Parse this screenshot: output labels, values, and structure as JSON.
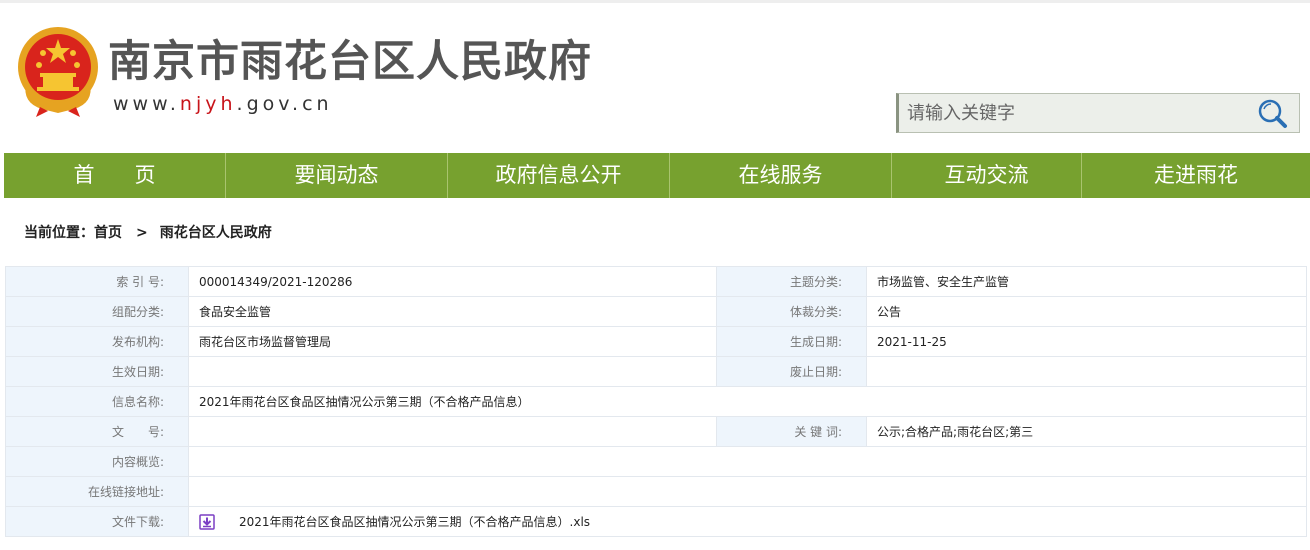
{
  "header": {
    "site_title": "南京市雨花台区人民政府",
    "url_prefix": "www.",
    "url_highlight": "njyh",
    "url_suffix": ".gov.cn",
    "search_placeholder": "请输入关键字",
    "emblem_icon": "national-emblem-icon",
    "search_icon": "search-icon"
  },
  "nav": {
    "items": [
      {
        "label": "首页"
      },
      {
        "label": "要闻动态"
      },
      {
        "label": "政府信息公开"
      },
      {
        "label": "在线服务"
      },
      {
        "label": "互动交流"
      },
      {
        "label": "走进雨花"
      }
    ]
  },
  "breadcrumb": {
    "prefix": "当前位置：",
    "home": "首页",
    "separator": ">",
    "current": "雨花台区人民政府"
  },
  "meta": {
    "index_label": "索 引 号:",
    "index_value": "000014349/2021-120286",
    "topic_label": "主题分类:",
    "topic_value": "市场监管、安全生产监管",
    "group_label": "组配分类:",
    "group_value": "食品安全监管",
    "genre_label": "体裁分类:",
    "genre_value": "公告",
    "publisher_label": "发布机构:",
    "publisher_value": "雨花台区市场监督管理局",
    "created_label": "生成日期:",
    "created_value": "2021-11-25",
    "effective_label": "生效日期:",
    "effective_value": "",
    "expiry_label": "废止日期:",
    "expiry_value": "",
    "title_label": "信息名称:",
    "title_value": "2021年雨花台区食品区抽情况公示第三期（不合格产品信息）",
    "doc_no_label": "文　　号:",
    "doc_no_value": "",
    "keywords_label": "关 键 词:",
    "keywords_value": "公示;合格产品;雨花台区;第三",
    "summary_label": "内容概览:",
    "summary_value": "",
    "link_label": "在线链接地址:",
    "link_value": "",
    "download_label": "文件下载:",
    "download_file": "2021年雨花台区食品区抽情况公示第三期（不合格产品信息）.xls",
    "download_icon": "download-icon"
  },
  "colors": {
    "nav_bg": "#77a12f",
    "label_bg": "#eef5fc",
    "url_red": "#c8141a",
    "download_purple": "#7b3fc4"
  }
}
